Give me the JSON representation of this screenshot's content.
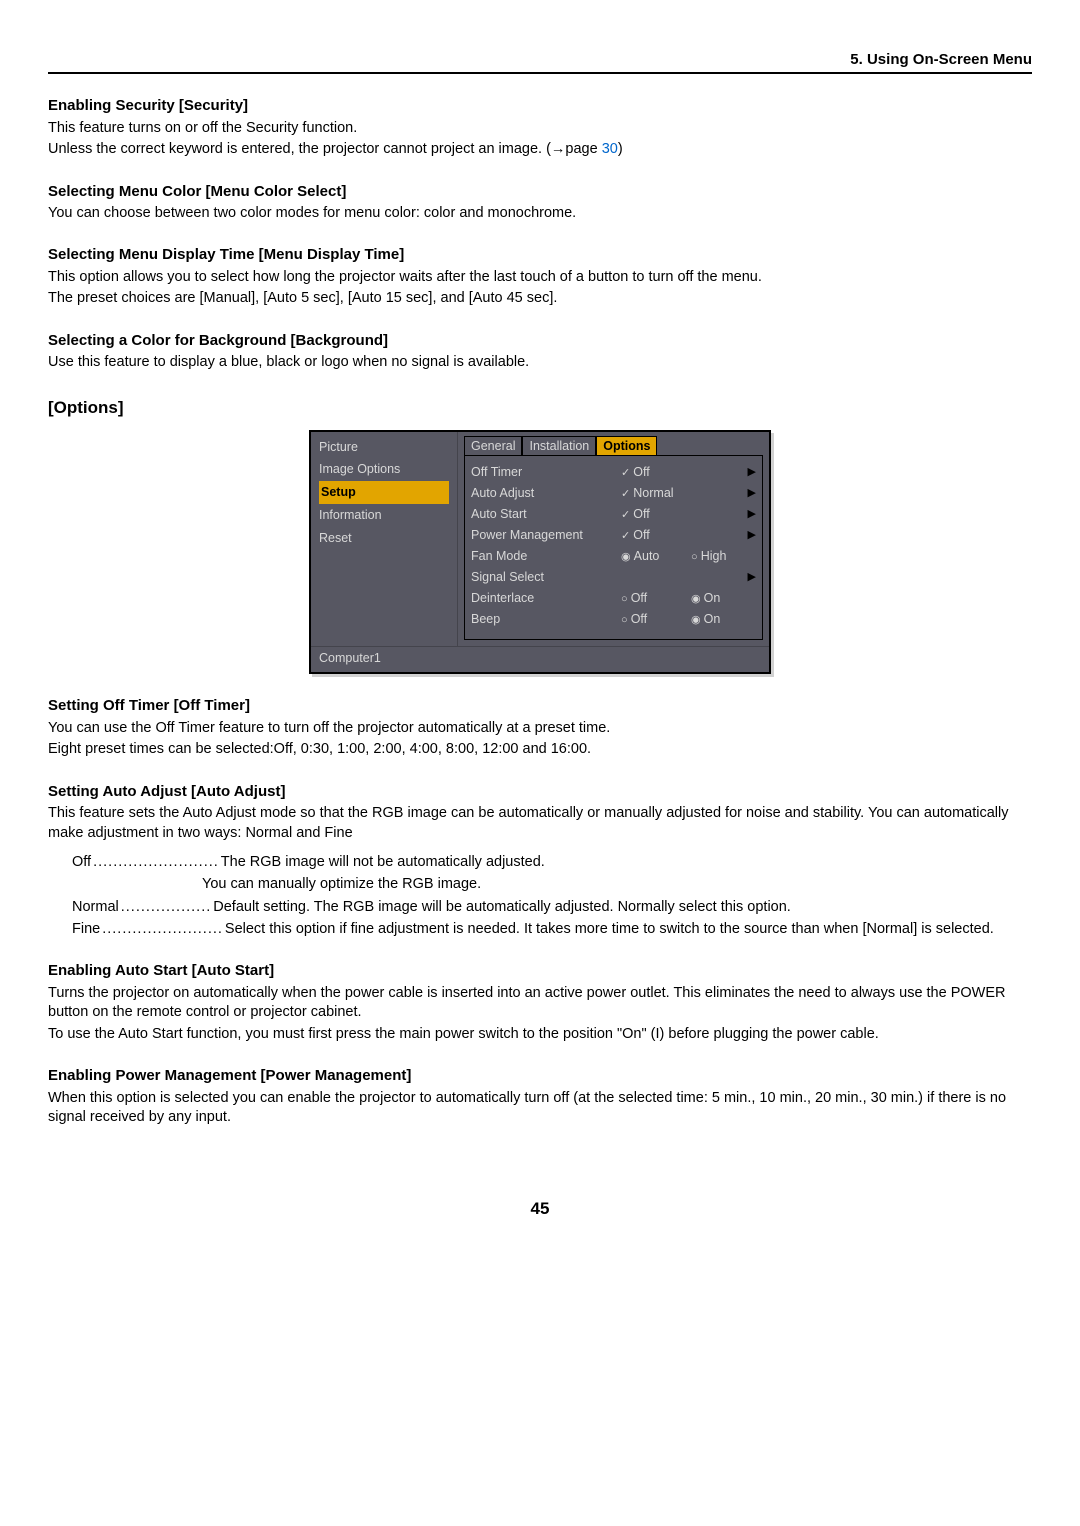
{
  "header": {
    "title": "5. Using On-Screen Menu"
  },
  "sec1": {
    "h": "Enabling Security [Security]",
    "p1": "This feature turns on or off the Security function.",
    "p2a": "Unless the correct keyword is entered, the projector cannot project an image. (→page ",
    "link": "30",
    "p2b": ")"
  },
  "sec2": {
    "h": "Selecting Menu Color [Menu Color Select]",
    "p": "You can choose between two color modes for menu color: color and monochrome."
  },
  "sec3": {
    "h": "Selecting Menu Display Time [Menu Display Time]",
    "p1": "This option allows you to select how long the projector waits after the last touch of a button to turn off the menu.",
    "p2": "The preset choices are [Manual], [Auto 5 sec], [Auto 15 sec], and [Auto 45 sec]."
  },
  "sec4": {
    "h": "Selecting a Color for Background [Background]",
    "p": "Use this feature to display a blue, black or logo when no signal is available."
  },
  "options_h": "[Options]",
  "menu": {
    "left": {
      "picture": "Picture",
      "image_options": "Image Options",
      "setup": "Setup",
      "information": "Information",
      "reset": "Reset"
    },
    "tabs": {
      "general": "General",
      "installation": "Installation",
      "options": "Options"
    },
    "rows": {
      "off_timer": {
        "label": "Off Timer",
        "val": "Off"
      },
      "auto_adjust": {
        "label": "Auto Adjust",
        "val": "Normal"
      },
      "auto_start": {
        "label": "Auto Start",
        "val": "Off"
      },
      "power_mgmt": {
        "label": "Power Management",
        "val": "Off"
      },
      "fan_mode": {
        "label": "Fan Mode",
        "auto": "Auto",
        "high": "High"
      },
      "signal_sel": {
        "label": "Signal Select"
      },
      "deinterlace": {
        "label": "Deinterlace",
        "off": "Off",
        "on": "On"
      },
      "beep": {
        "label": "Beep",
        "off": "Off",
        "on": "On"
      }
    },
    "footer": "Computer1"
  },
  "sec5": {
    "h": "Setting Off Timer [Off Timer]",
    "p1": "You can use the Off Timer feature to turn off the projector automatically at a preset time.",
    "p2": "Eight preset times can be selected:Off, 0:30, 1:00, 2:00, 4:00, 8:00, 12:00 and 16:00."
  },
  "sec6": {
    "h": "Setting Auto Adjust [Auto Adjust]",
    "p": "This feature sets the Auto Adjust mode so that the RGB image can be automatically or manually adjusted for noise and stability. You can automatically make adjustment in two ways: Normal and Fine",
    "defs": {
      "off_t": "Off",
      "off_b1": "The RGB image will not be automatically adjusted.",
      "off_b2": "You can manually optimize the RGB image.",
      "normal_t": "Normal",
      "normal_b": "Default setting. The RGB image will be automatically adjusted. Normally select this option.",
      "fine_t": "Fine",
      "fine_b": "Select this option if fine adjustment is needed. It takes more time to switch to the source than when [Normal] is selected."
    }
  },
  "sec7": {
    "h": "Enabling Auto Start [Auto Start]",
    "p1": "Turns the projector on automatically when the power cable is inserted into an active power outlet. This eliminates the need to always use the POWER button on the remote control or projector cabinet.",
    "p2": "To use the Auto Start function, you must first press the main power switch to the position \"On\" (I) before plugging the power cable."
  },
  "sec8": {
    "h": "Enabling Power Management [Power Management]",
    "p": "When this option is selected you can enable the projector to automatically turn off (at the selected time: 5 min., 10 min., 20 min., 30 min.) if there is no signal received by any input."
  },
  "page_num": "45"
}
